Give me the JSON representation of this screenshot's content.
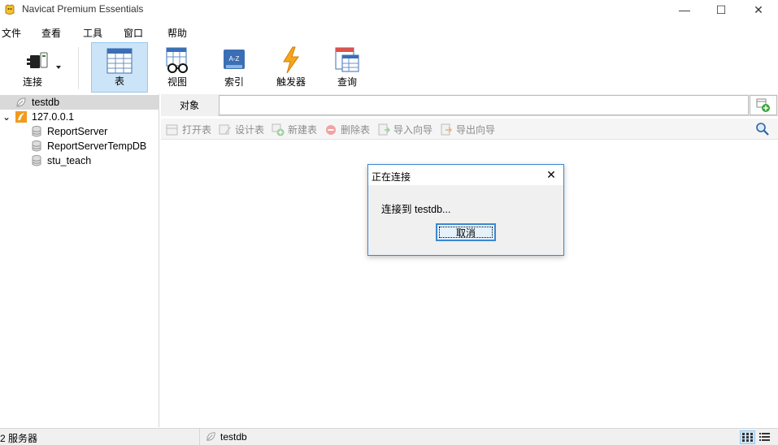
{
  "window": {
    "title": "Navicat Premium Essentials",
    "minimize_glyph": "—",
    "maximize_glyph": "☐",
    "close_glyph": "✕"
  },
  "menu": [
    "文件",
    "查看",
    "工具",
    "窗口",
    "帮助"
  ],
  "toolbar": {
    "connect": "连接",
    "table": "表",
    "view": "视图",
    "index": "索引",
    "trigger": "触发器",
    "query": "查询"
  },
  "tree": {
    "items": [
      {
        "label": "testdb",
        "icon": "connection-leaf-icon",
        "selected": true
      },
      {
        "label": "127.0.0.1",
        "icon": "sqlserver-server-icon",
        "expanded": true
      },
      {
        "label": "ReportServer",
        "icon": "database-icon"
      },
      {
        "label": "ReportServerTempDB",
        "icon": "database-icon"
      },
      {
        "label": "stu_teach",
        "icon": "database-icon"
      }
    ],
    "expand_glyph": "⌄"
  },
  "objects": {
    "tab_label": "对象",
    "search_value": "",
    "actions": [
      "打开表",
      "设计表",
      "新建表",
      "删除表",
      "导入向导",
      "导出向导"
    ]
  },
  "dialog": {
    "title": "正在连接",
    "message": "连接到 testdb...",
    "cancel": "取消",
    "close_glyph": "✕"
  },
  "status": {
    "servers": "2 服务器",
    "connection": "testdb"
  },
  "colors": {
    "accent": "#0078d7",
    "active_tool_bg": "#cce4f7",
    "dialog_border": "#3a88d2"
  }
}
